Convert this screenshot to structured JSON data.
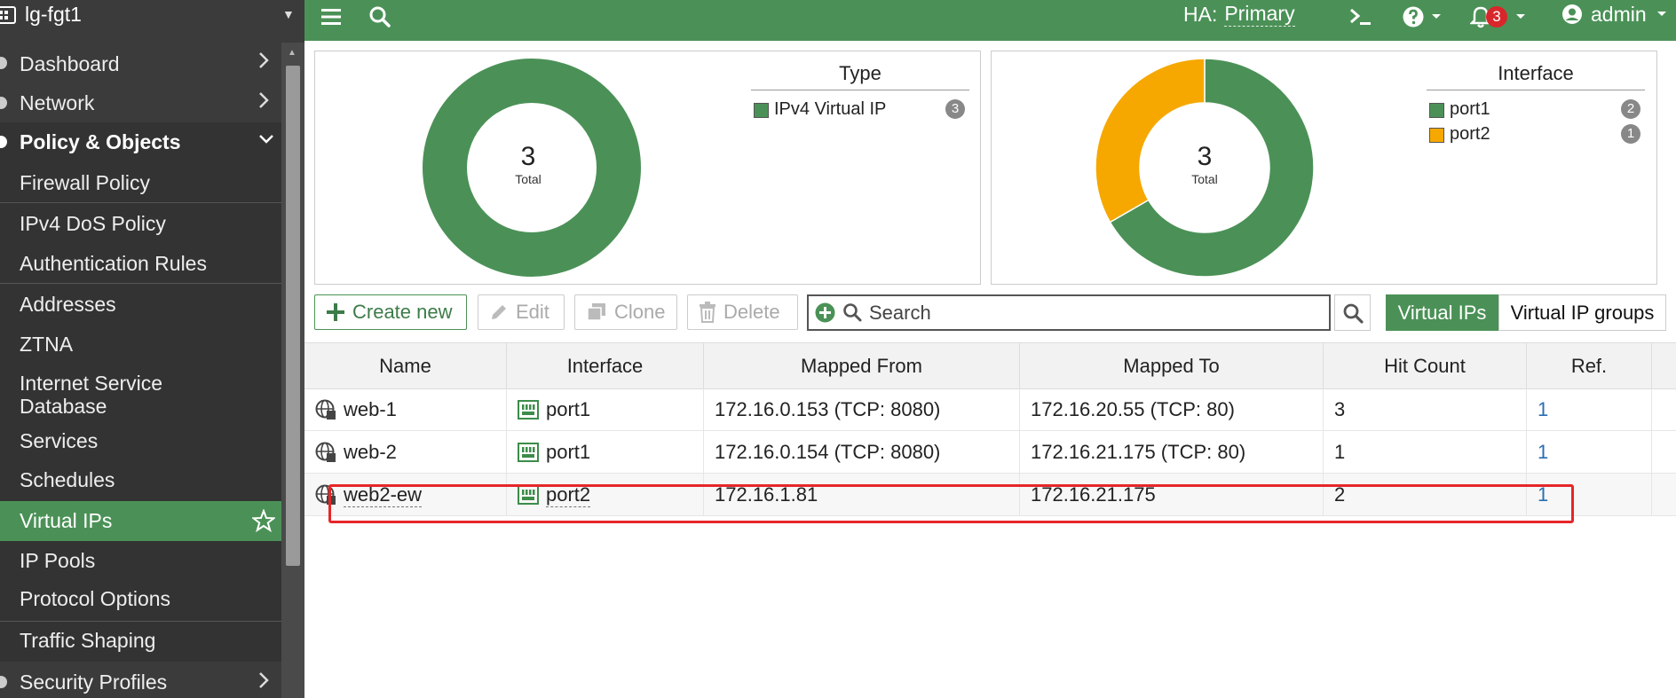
{
  "sidebar": {
    "device_name": "lg-fgt1",
    "items": [
      {
        "label": "Dashboard",
        "kind": "parent"
      },
      {
        "label": "Network",
        "kind": "parent"
      },
      {
        "label": "Policy & Objects",
        "kind": "open"
      },
      {
        "label": "Firewall Policy",
        "kind": "child"
      },
      {
        "label": "IPv4 DoS Policy",
        "kind": "child"
      },
      {
        "label": "Authentication Rules",
        "kind": "child"
      },
      {
        "label": "Addresses",
        "kind": "child"
      },
      {
        "label": "ZTNA",
        "kind": "child"
      },
      {
        "label": "Internet Service Database",
        "kind": "child"
      },
      {
        "label": "Services",
        "kind": "child"
      },
      {
        "label": "Schedules",
        "kind": "child"
      },
      {
        "label": "Virtual IPs",
        "kind": "active"
      },
      {
        "label": "IP Pools",
        "kind": "child"
      },
      {
        "label": "Protocol Options",
        "kind": "child"
      },
      {
        "label": "Traffic Shaping",
        "kind": "child"
      },
      {
        "label": "Security Profiles",
        "kind": "parent"
      }
    ]
  },
  "topbar": {
    "ha_label": "HA:",
    "ha_value": "Primary",
    "notifications_count": "3",
    "user": "admin"
  },
  "cards": {
    "type": {
      "title": "Type",
      "total": "3",
      "total_label": "Total",
      "legend": [
        {
          "name": "IPv4 Virtual IP",
          "count": "3",
          "color": "#4b9157"
        }
      ]
    },
    "interface": {
      "title": "Interface",
      "total": "3",
      "total_label": "Total",
      "legend": [
        {
          "name": "port1",
          "count": "2",
          "color": "#4b9157"
        },
        {
          "name": "port2",
          "count": "1",
          "color": "#f6a800"
        }
      ]
    }
  },
  "chart_data": [
    {
      "type": "pie",
      "title": "Type",
      "categories": [
        "IPv4 Virtual IP"
      ],
      "values": [
        3
      ],
      "colors": [
        "#4b9157"
      ]
    },
    {
      "type": "pie",
      "title": "Interface",
      "categories": [
        "port1",
        "port2"
      ],
      "values": [
        2,
        1
      ],
      "colors": [
        "#4b9157",
        "#f6a800"
      ]
    }
  ],
  "toolbar": {
    "create_label": "Create new",
    "edit_label": "Edit",
    "clone_label": "Clone",
    "delete_label": "Delete",
    "search_placeholder": "Search",
    "tab_vips": "Virtual IPs",
    "tab_groups": "Virtual IP groups"
  },
  "table": {
    "columns": [
      "Name",
      "Interface",
      "Mapped From",
      "Mapped To",
      "Hit Count",
      "Ref."
    ],
    "rows": [
      {
        "name": "web-1",
        "interface": "port1",
        "mapped_from": "172.16.0.153 (TCP: 8080)",
        "mapped_to": "172.16.20.55 (TCP: 80)",
        "hit_count": "3",
        "ref": "1"
      },
      {
        "name": "web-2",
        "interface": "port1",
        "mapped_from": "172.16.0.154 (TCP: 8080)",
        "mapped_to": "172.16.21.175 (TCP: 80)",
        "hit_count": "1",
        "ref": "1"
      },
      {
        "name": "web2-ew",
        "interface": "port2",
        "mapped_from": "172.16.1.81",
        "mapped_to": "172.16.21.175",
        "hit_count": "2",
        "ref": "1"
      }
    ]
  },
  "colors": {
    "accent": "#4b9157",
    "accent_alt": "#f6a800",
    "sidebar_bg": "#3b3b3b",
    "highlight": "#e6262a",
    "link": "#2a6eb3"
  }
}
